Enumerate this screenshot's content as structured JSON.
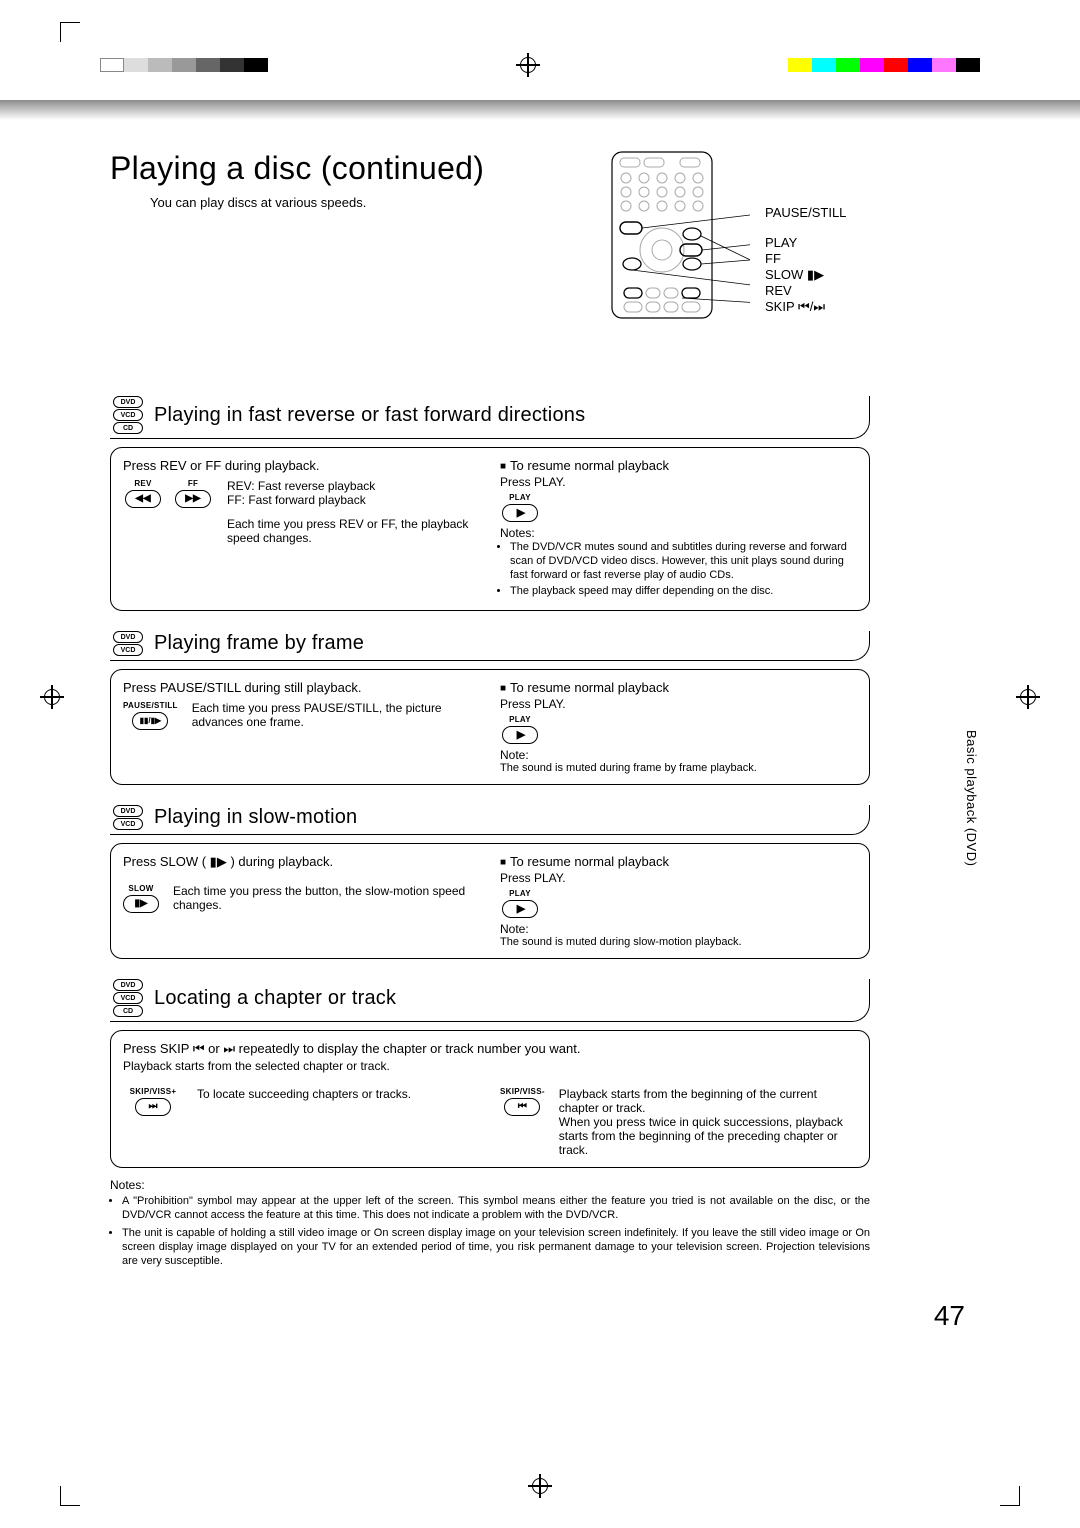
{
  "page": {
    "title": "Playing a disc (continued)",
    "intro": "You can play discs at various speeds.",
    "page_number": "47",
    "side_tab": "Basic playback (DVD)"
  },
  "remote": {
    "labels": {
      "pause": "PAUSE/STILL",
      "play": "PLAY",
      "ff": "FF",
      "slow": "SLOW",
      "rev": "REV",
      "skip": "SKIP"
    },
    "glyphs": {
      "slow": "▮▶",
      "skip": "⏮/⏭"
    }
  },
  "sections": {
    "fastrev": {
      "discs": [
        "DVD",
        "VCD",
        "CD"
      ],
      "title": "Playing in fast reverse or fast forward directions",
      "left_instr": "Press REV or FF during playback.",
      "btn_rev": "REV",
      "btn_ff": "FF",
      "rev_glyph": "◀◀",
      "ff_glyph": "▶▶",
      "def_rev": "REV:  Fast reverse playback",
      "def_ff": "FF:    Fast forward playback",
      "left_note": "Each time you press REV or FF, the playback speed changes.",
      "resume_head": "To resume normal playback",
      "resume_body": "Press PLAY.",
      "play_label": "PLAY",
      "notes_label": "Notes:",
      "notes": [
        "The DVD/VCR mutes sound and subtitles during reverse and forward scan of DVD/VCD video discs. However, this unit plays sound during fast forward or fast reverse play of audio CDs.",
        "The playback speed may differ depending on the disc."
      ]
    },
    "frame": {
      "discs": [
        "DVD",
        "VCD"
      ],
      "title": "Playing frame by frame",
      "left_instr": "Press PAUSE/STILL during still playback.",
      "btn_pause": "PAUSE/STILL",
      "pause_glyph": "▮▮/▮▶",
      "left_note": "Each time you press PAUSE/STILL, the picture advances one frame.",
      "resume_head": "To resume normal playback",
      "resume_body": "Press PLAY.",
      "play_label": "PLAY",
      "note_label": "Note:",
      "note": "The sound is muted during frame by frame playback."
    },
    "slow": {
      "discs": [
        "DVD",
        "VCD"
      ],
      "title": "Playing in slow-motion",
      "left_instr": "Press SLOW ( ▮▶ ) during playback.",
      "btn_slow": "SLOW",
      "slow_glyph": "▮▶",
      "left_note": "Each time you press the button, the slow-motion speed changes.",
      "resume_head": "To resume normal playback",
      "resume_body": "Press PLAY.",
      "play_label": "PLAY",
      "note_label": "Note:",
      "note": "The sound is muted during slow-motion playback."
    },
    "locate": {
      "discs": [
        "DVD",
        "VCD",
        "CD"
      ],
      "title": "Locating a chapter or track",
      "instr": "Press SKIP ⏮ or ⏭ repeatedly to display the chapter or track number you want.",
      "sub": "Playback starts from the selected chapter or track.",
      "btn_skip_plus": "SKIP/VISS+",
      "skip_plus_glyph": "⏭",
      "skip_plus_text": "To locate succeeding chapters or tracks.",
      "btn_skip_minus": "SKIP/VISS-",
      "skip_minus_glyph": "⏮",
      "skip_minus_text1": "Playback starts from the beginning of the current chapter or track.",
      "skip_minus_text2": "When you press twice in quick successions, playback starts from the beginning of the preceding chapter or track."
    }
  },
  "footer": {
    "label": "Notes:",
    "items": [
      "A \"Prohibition\" symbol            may appear at the upper left of the screen. This symbol means either the feature you tried is not available on the disc, or the DVD/VCR cannot access the feature at this time. This does not indicate a problem with the DVD/VCR.",
      "The unit is capable of holding a still video image or On screen display image on your television screen indefinitely. If you leave the still video image or On screen display image displayed on your TV for an extended period of time, you risk permanent damage to your television screen. Projection televisions are very susceptible."
    ]
  }
}
